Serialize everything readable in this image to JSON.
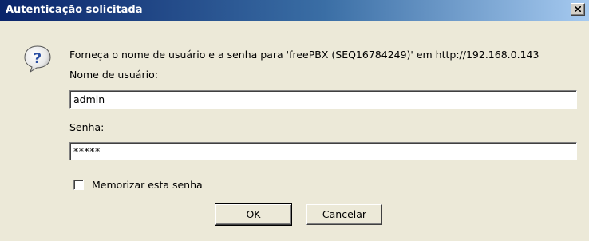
{
  "window": {
    "title": "Autenticação solicitada",
    "close_icon": "close-icon"
  },
  "dialog": {
    "icon": "question-icon",
    "message": "Forneça o nome de usuário e a senha para 'freePBX (SEQ16784249)' em http://192.168.0.143",
    "username_label": "Nome de usuário:",
    "username_value": "admin",
    "password_label": "Senha:",
    "password_value": "*****",
    "remember_label": "Memorizar esta senha",
    "remember_checked": false
  },
  "buttons": {
    "ok_label": "OK",
    "cancel_label": "Cancelar"
  }
}
